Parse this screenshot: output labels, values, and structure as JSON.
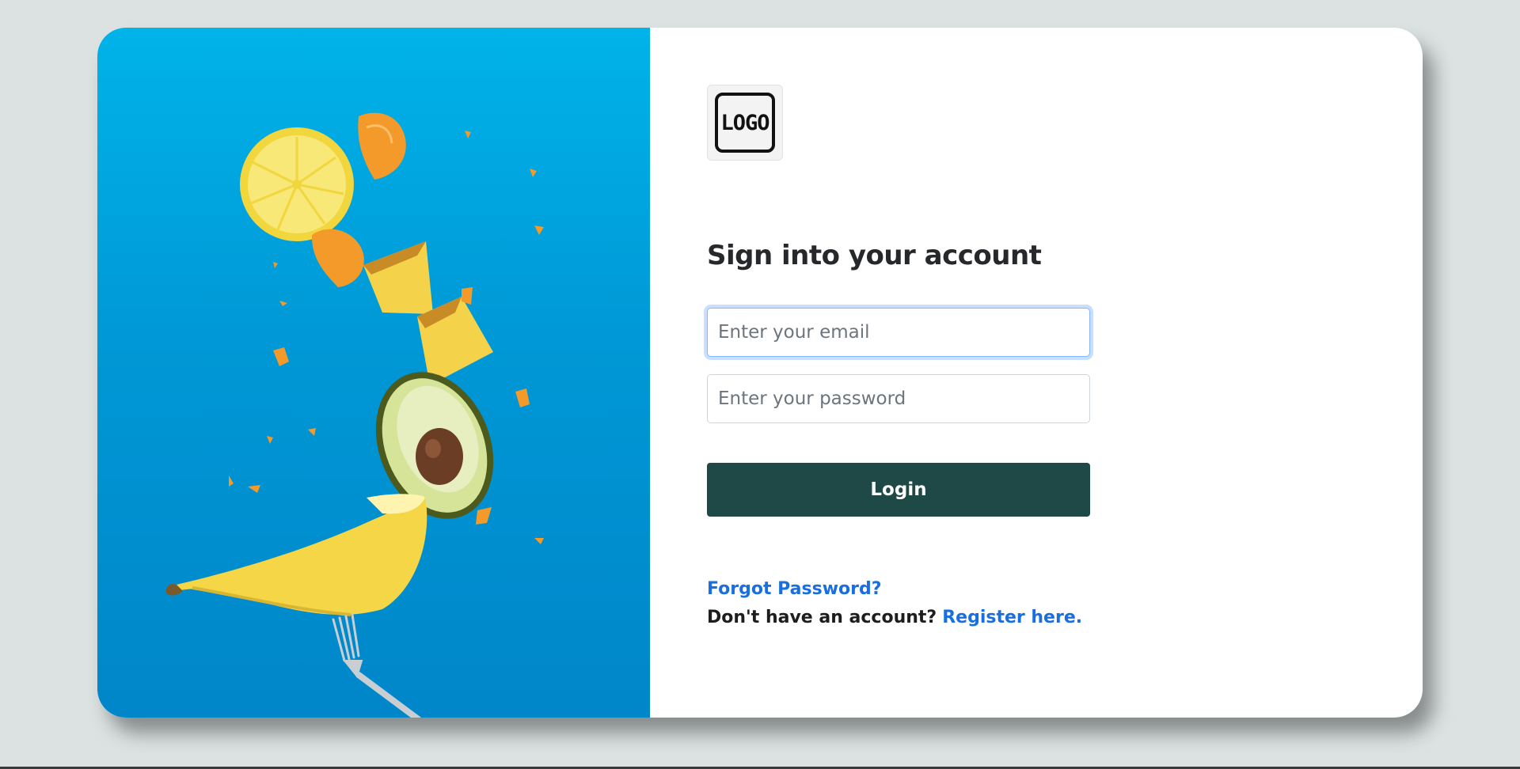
{
  "logo": {
    "text": "LOGO"
  },
  "form": {
    "title": "Sign into your account",
    "email_placeholder": "Enter your email",
    "password_placeholder": "Enter your password",
    "login_label": "Login",
    "forgot_label": "Forgot Password?",
    "register_prompt": "Don't have an account?",
    "register_link": "Register here."
  },
  "colors": {
    "page_background": "#dce2e2",
    "hero_blue": "#00a2dc",
    "login_button": "#1f4946",
    "link": "#1a6fe0"
  }
}
